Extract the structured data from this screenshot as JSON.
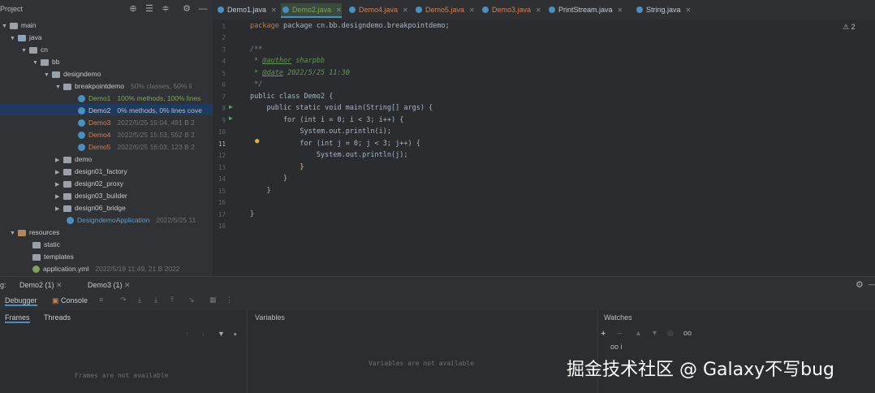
{
  "project": {
    "title": "Project",
    "tree": [
      {
        "label": "main",
        "meta": ""
      },
      {
        "label": "java",
        "meta": ""
      },
      {
        "label": "cn",
        "meta": ""
      },
      {
        "label": "bb",
        "meta": ""
      },
      {
        "label": "designdemo",
        "meta": ""
      },
      {
        "label": "breakpointdemo",
        "meta": "50% classes, 50% li"
      },
      {
        "label": "Demo1",
        "meta": "100% methods, 100% lines"
      },
      {
        "label": "Demo2",
        "meta": "0% methods, 0% lines cove"
      },
      {
        "label": "Demo3",
        "meta": "2022/5/25 15:04, 491 B 2"
      },
      {
        "label": "Demo4",
        "meta": "2022/5/25 15:53, 552 B 2"
      },
      {
        "label": "Demo5",
        "meta": "2022/5/25 16:03, 123 B 2"
      },
      {
        "label": "demo",
        "meta": ""
      },
      {
        "label": "design01_factory",
        "meta": ""
      },
      {
        "label": "design02_proxy",
        "meta": ""
      },
      {
        "label": "design03_builder",
        "meta": ""
      },
      {
        "label": "design06_bridge",
        "meta": ""
      },
      {
        "label": "DesigndemoApplication",
        "meta": "2022/5/25 11"
      },
      {
        "label": "resources",
        "meta": ""
      },
      {
        "label": "static",
        "meta": ""
      },
      {
        "label": "templates",
        "meta": ""
      },
      {
        "label": "application.yml",
        "meta": "2022/5/19 11:49, 21 B 2022"
      }
    ]
  },
  "tabs": [
    "Demo1.java",
    "Demo2.java",
    "Demo4.java",
    "Demo5.java",
    "Demo3.java",
    "PrintStream.java",
    "String.java"
  ],
  "warnings": "⚠ 2",
  "line_numbers": [
    "1",
    "2",
    "3",
    "4",
    "5",
    "6",
    "7",
    "8",
    "9",
    "10",
    "11",
    "12",
    "13",
    "14",
    "15",
    "16",
    "17",
    "18"
  ],
  "code": {
    "l1": "package cn.bb.designdemo.breakpointdemo;",
    "l3": "/**",
    "l4_tag": "@author",
    "l4_text": " sharpbb",
    "l5_tag": "@date",
    "l5_text": " 2022/5/25 11:30",
    "l6": " */",
    "l7": "public class Demo2 {",
    "l8": "    public static void main(String[] args) {",
    "l9": "        for (int i = 0; i < 3; i++) {",
    "l10": "            System.out.println(i);",
    "l11": "            for (int j = 0; j < 3; j++) {",
    "l12": "                System.out.println(j);",
    "l13": "            }",
    "l14": "        }",
    "l15": "    }",
    "l17": "}"
  },
  "debug": {
    "label": "g:",
    "sessions": [
      "Demo2 (1)",
      "Demo3 (1)"
    ],
    "tool_tabs": [
      "Debugger",
      "Console"
    ],
    "frames_tab": "Frames",
    "threads_tab": "Threads",
    "variables_title": "Variables",
    "watches_title": "Watches",
    "frames_empty": "Frames are not available",
    "variables_empty": "Variables are not available",
    "watch_item": "oo i"
  },
  "watermark": "掘金技术社区 @ Galaxy不写bug"
}
